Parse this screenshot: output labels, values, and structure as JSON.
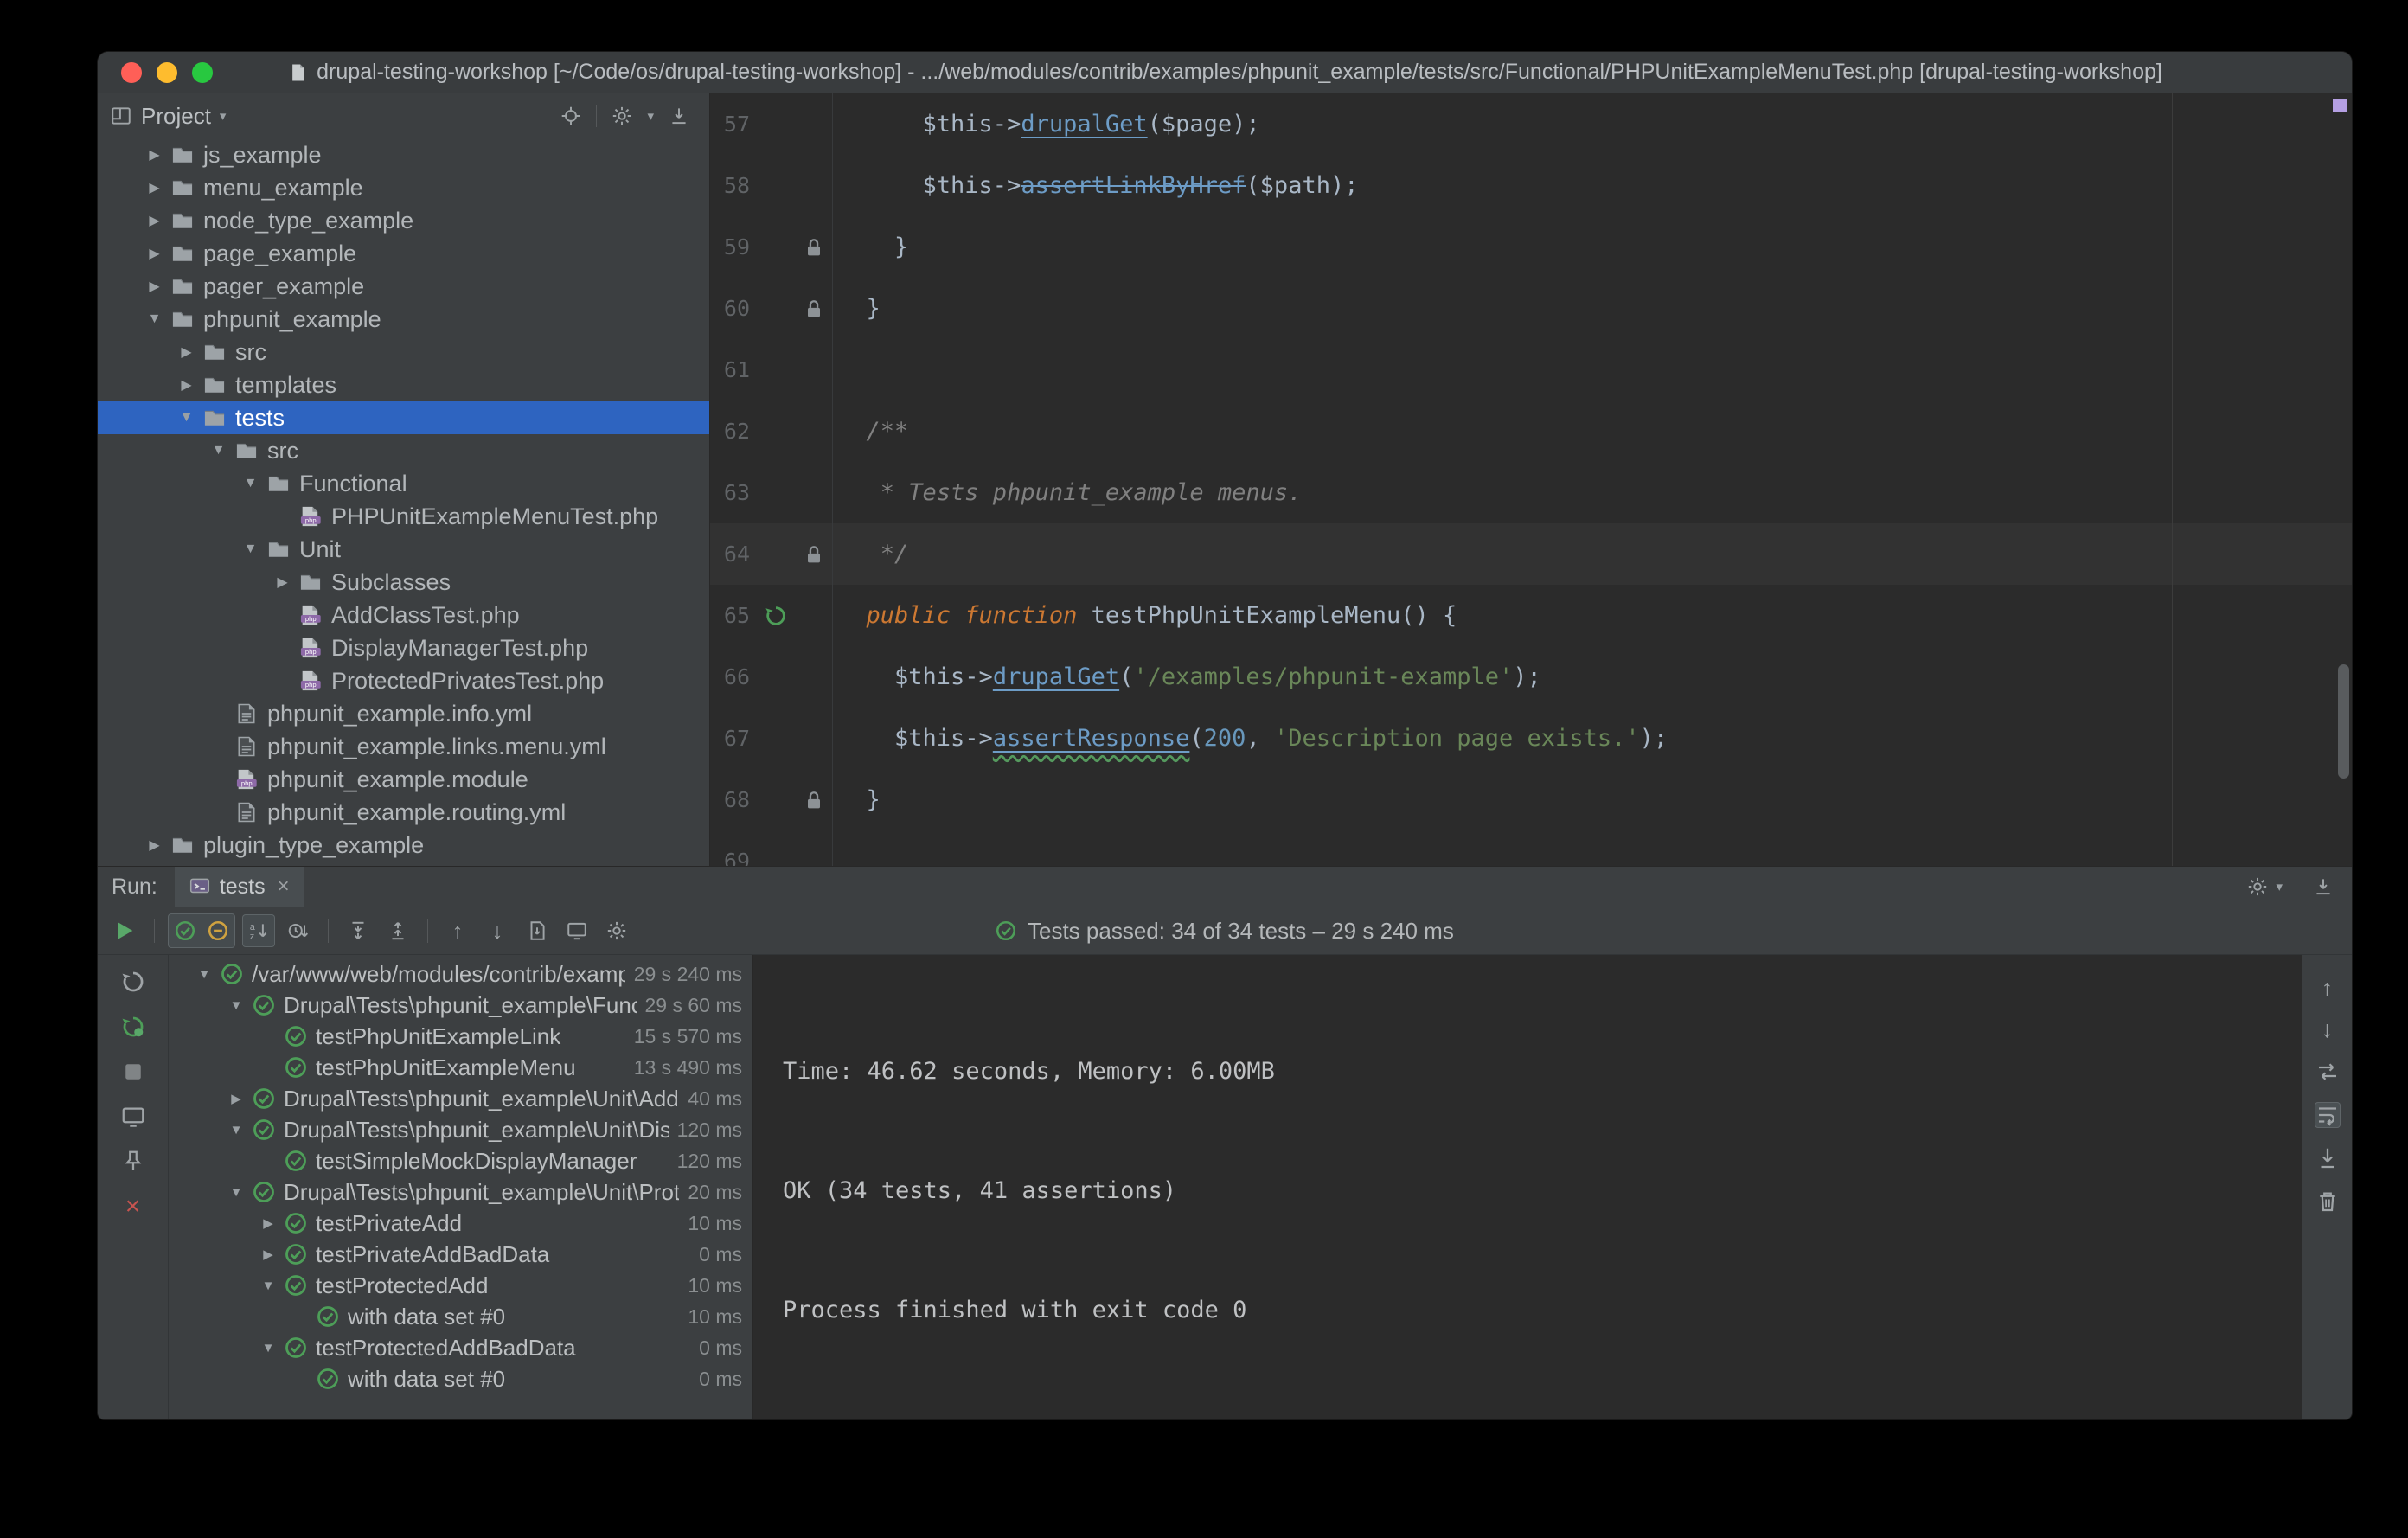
{
  "icons": {
    "chevron_down": "▼",
    "chevron_right": "▶",
    "caret_down": "▾",
    "arrow_up": "↑",
    "arrow_down": "↓",
    "close": "×"
  },
  "colors": {
    "selection_blue": "#2e64c0",
    "pass_green": "#4d9e58",
    "close_red": "#c75450",
    "keyword_orange": "#cc7832",
    "string_green": "#6a8759",
    "number_blue": "#6897bb",
    "method_blue": "#6d9cc6",
    "error_stripe_purple": "#b5a0e3"
  },
  "title_bar": {
    "title": "drupal-testing-workshop [~/Code/os/drupal-testing-workshop] - .../web/modules/contrib/examples/phpunit_example/tests/src/Functional/PHPUnitExampleMenuTest.php [drupal-testing-workshop]"
  },
  "project_panel": {
    "header_label": "Project",
    "tree": [
      {
        "label": "js_example",
        "icon": "folder",
        "depth": 1,
        "arrow": "right"
      },
      {
        "label": "menu_example",
        "icon": "folder",
        "depth": 1,
        "arrow": "right"
      },
      {
        "label": "node_type_example",
        "icon": "folder",
        "depth": 1,
        "arrow": "right"
      },
      {
        "label": "page_example",
        "icon": "folder",
        "depth": 1,
        "arrow": "right"
      },
      {
        "label": "pager_example",
        "icon": "folder",
        "depth": 1,
        "arrow": "right"
      },
      {
        "label": "phpunit_example",
        "icon": "folder",
        "depth": 1,
        "arrow": "down"
      },
      {
        "label": "src",
        "icon": "folder",
        "depth": 2,
        "arrow": "right"
      },
      {
        "label": "templates",
        "icon": "folder",
        "depth": 2,
        "arrow": "right"
      },
      {
        "label": "tests",
        "icon": "folder",
        "depth": 2,
        "arrow": "down",
        "selected": true
      },
      {
        "label": "src",
        "icon": "folder",
        "depth": 3,
        "arrow": "down"
      },
      {
        "label": "Functional",
        "icon": "folder",
        "depth": 4,
        "arrow": "down"
      },
      {
        "label": "PHPUnitExampleMenuTest.php",
        "icon": "php",
        "depth": 5,
        "arrow": null
      },
      {
        "label": "Unit",
        "icon": "folder",
        "depth": 4,
        "arrow": "down"
      },
      {
        "label": "Subclasses",
        "icon": "folder",
        "depth": 5,
        "arrow": "right"
      },
      {
        "label": "AddClassTest.php",
        "icon": "php",
        "depth": 5,
        "arrow": null
      },
      {
        "label": "DisplayManagerTest.php",
        "icon": "php",
        "depth": 5,
        "arrow": null
      },
      {
        "label": "ProtectedPrivatesTest.php",
        "icon": "php",
        "depth": 5,
        "arrow": null
      },
      {
        "label": "phpunit_example.info.yml",
        "icon": "yml",
        "depth": 3,
        "arrow": null
      },
      {
        "label": "phpunit_example.links.menu.yml",
        "icon": "yml",
        "depth": 3,
        "arrow": null
      },
      {
        "label": "phpunit_example.module",
        "icon": "php",
        "depth": 3,
        "arrow": null
      },
      {
        "label": "phpunit_example.routing.yml",
        "icon": "yml",
        "depth": 3,
        "arrow": null
      },
      {
        "label": "plugin_type_example",
        "icon": "folder",
        "depth": 1,
        "arrow": "right"
      }
    ]
  },
  "editor": {
    "lines": [
      {
        "num": "57",
        "tokens": [
          [
            "plain",
            "      $this->"
          ],
          [
            "method",
            "drupalGet"
          ],
          [
            "plain",
            "($page);"
          ]
        ]
      },
      {
        "num": "58",
        "tokens": [
          [
            "plain",
            "      $this->"
          ],
          [
            "method_strike",
            "assertLinkByHref"
          ],
          [
            "plain",
            "($path);"
          ]
        ]
      },
      {
        "num": "59",
        "gutter": "lock",
        "tokens": [
          [
            "plain",
            "    }"
          ]
        ]
      },
      {
        "num": "60",
        "gutter": "lock",
        "tokens": [
          [
            "plain",
            "  }"
          ]
        ]
      },
      {
        "num": "61",
        "tokens": []
      },
      {
        "num": "62",
        "tokens": [
          [
            "comment",
            "  /**"
          ]
        ]
      },
      {
        "num": "63",
        "tokens": [
          [
            "comment",
            "   * Tests phpunit_example menus."
          ]
        ]
      },
      {
        "num": "64",
        "gutter": "lock",
        "current": true,
        "tokens": [
          [
            "comment",
            "   */"
          ]
        ]
      },
      {
        "num": "65",
        "gutter": "run",
        "tokens": [
          [
            "keyword",
            "  public function "
          ],
          [
            "plain",
            "testPhpUnitExampleMenu() {"
          ]
        ]
      },
      {
        "num": "66",
        "tokens": [
          [
            "plain",
            "    $this->"
          ],
          [
            "method",
            "drupalGet"
          ],
          [
            "plain",
            "("
          ],
          [
            "string",
            "'/examples/phpunit-example'"
          ],
          [
            "plain",
            ");"
          ]
        ]
      },
      {
        "num": "67",
        "tokens": [
          [
            "plain",
            "    $this->"
          ],
          [
            "method_warn",
            "assertResponse"
          ],
          [
            "plain",
            "("
          ],
          [
            "number",
            "200"
          ],
          [
            "plain",
            ", "
          ],
          [
            "string",
            "'Description page exists.'"
          ],
          [
            "plain",
            ");"
          ]
        ]
      },
      {
        "num": "68",
        "gutter": "lock",
        "tokens": [
          [
            "plain",
            "  }"
          ]
        ]
      },
      {
        "num": "69",
        "tokens": []
      }
    ]
  },
  "run_panel": {
    "run_label": "Run:",
    "tab_label": "tests",
    "status_text": "Tests passed: 34 of 34 tests – 29 s 240 ms",
    "tree": [
      {
        "label": "/var/www/web/modules/contrib/examples/phpunit_example",
        "time": "29 s 240 ms",
        "depth": 0,
        "arrow": "down"
      },
      {
        "label": "Drupal\\Tests\\phpunit_example\\Functional\\PHPUnitExampleMenuTest",
        "time": "29 s 60 ms",
        "depth": 1,
        "arrow": "down"
      },
      {
        "label": "testPhpUnitExampleLink",
        "time": "15 s 570 ms",
        "depth": 2,
        "arrow": null
      },
      {
        "label": "testPhpUnitExampleMenu",
        "time": "13 s 490 ms",
        "depth": 2,
        "arrow": null
      },
      {
        "label": "Drupal\\Tests\\phpunit_example\\Unit\\AddClassTest",
        "time": "40 ms",
        "depth": 1,
        "arrow": "right"
      },
      {
        "label": "Drupal\\Tests\\phpunit_example\\Unit\\DisplayManagerTest",
        "time": "120 ms",
        "depth": 1,
        "arrow": "down"
      },
      {
        "label": "testSimpleMockDisplayManager",
        "time": "120 ms",
        "depth": 2,
        "arrow": null
      },
      {
        "label": "Drupal\\Tests\\phpunit_example\\Unit\\ProtectedPrivatesTest",
        "time": "20 ms",
        "depth": 1,
        "arrow": "down"
      },
      {
        "label": "testPrivateAdd",
        "time": "10 ms",
        "depth": 2,
        "arrow": "right"
      },
      {
        "label": "testPrivateAddBadData",
        "time": "0 ms",
        "depth": 2,
        "arrow": "right"
      },
      {
        "label": "testProtectedAdd",
        "time": "10 ms",
        "depth": 2,
        "arrow": "down"
      },
      {
        "label": "with data set #0",
        "time": "10 ms",
        "depth": 3,
        "arrow": null
      },
      {
        "label": "testProtectedAddBadData",
        "time": "0 ms",
        "depth": 2,
        "arrow": "down"
      },
      {
        "label": "with data set #0",
        "time": "0 ms",
        "depth": 3,
        "arrow": null
      }
    ],
    "console_lines": [
      "",
      "",
      "Time: 46.62 seconds, Memory: 6.00MB",
      "",
      "",
      "OK (34 tests, 41 assertions)",
      "",
      "",
      "Process finished with exit code 0"
    ]
  }
}
